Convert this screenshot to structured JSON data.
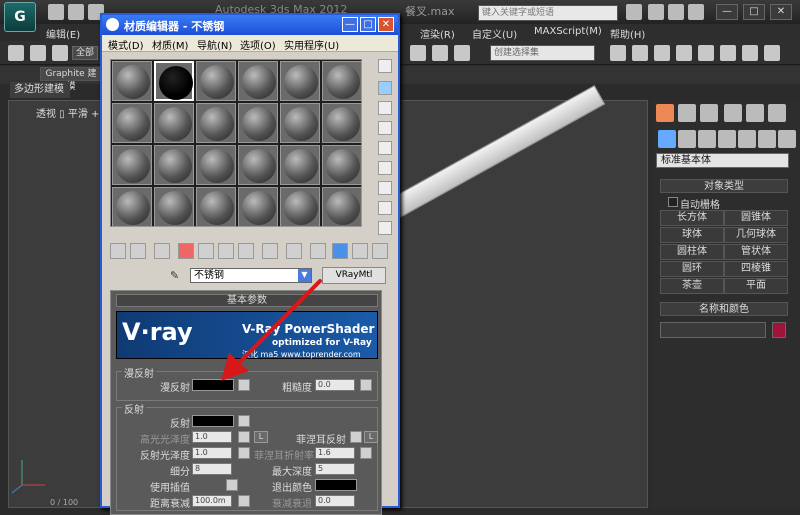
{
  "app": {
    "logo_glyph": "G",
    "title": "Autodesk 3ds Max  2012",
    "file": "餐叉.max",
    "search_placeholder": "键入关键字或短语",
    "window_buttons": [
      "—",
      "□",
      "✕"
    ]
  },
  "menubar": {
    "items": [
      "编辑(E)",
      "渲染(R)",
      "自定义(U)",
      "MAXScript(M)",
      "帮助(H)"
    ]
  },
  "toolbar": {
    "filter": "全部",
    "selection_set_placeholder": "创建选择集"
  },
  "ribbon": {
    "tab": "Graphite 建模",
    "sub": "多边形建模"
  },
  "viewport": {
    "label": "透视 ▯ 平滑 +"
  },
  "command_panel": {
    "category": "标准基本体",
    "object_type_title": "对象类型",
    "autogrid": "自动栅格",
    "primitives": [
      "长方体",
      "圆锥体",
      "球体",
      "几何球体",
      "圆柱体",
      "管状体",
      "圆环",
      "四棱锥",
      "茶壶",
      "平面"
    ],
    "name_color_title": "名称和颜色",
    "object_color": "#a0143c"
  },
  "material_editor": {
    "title": "材质编辑器 - 不锈钢",
    "menus": [
      "模式(D)",
      "材质(M)",
      "导航(N)",
      "选项(O)",
      "实用程序(U)"
    ],
    "material_name": "不锈钢",
    "material_type": "VRayMtl",
    "params_title": "基本参数",
    "banner": {
      "logo": "V·ray",
      "title": "V-Ray PowerShader",
      "subtitle": "optimized for V-Ray",
      "url": "汉化 ma5 www.toprender.com"
    },
    "diffuse_group": "漫反射",
    "diffuse_label": "漫反射",
    "roughness_label": "粗糙度",
    "roughness_value": "0.0",
    "reflection_group": "反射",
    "reflect_label": "反射",
    "hilight_gloss_label": "高光光泽度",
    "hilight_gloss_value": "1.0",
    "fresnel_label": "菲涅耳反射",
    "lock_label": "L",
    "refl_gloss_label": "反射光泽度",
    "refl_gloss_value": "1.0",
    "fresnel_ior_label": "菲涅耳折射率",
    "fresnel_ior_value": "1.6",
    "subdivs_label": "细分",
    "subdivs_value": "8",
    "max_depth_label": "最大深度",
    "max_depth_value": "5",
    "use_interp_label": "使用插值",
    "exit_color_label": "退出颜色",
    "dim_dist_label": "距离衰减",
    "dim_dist_value": "100.0m",
    "dim_falloff_label": "衰减衰退",
    "dim_falloff_value": "0.0"
  },
  "status": {
    "frame": "0 / 100"
  }
}
